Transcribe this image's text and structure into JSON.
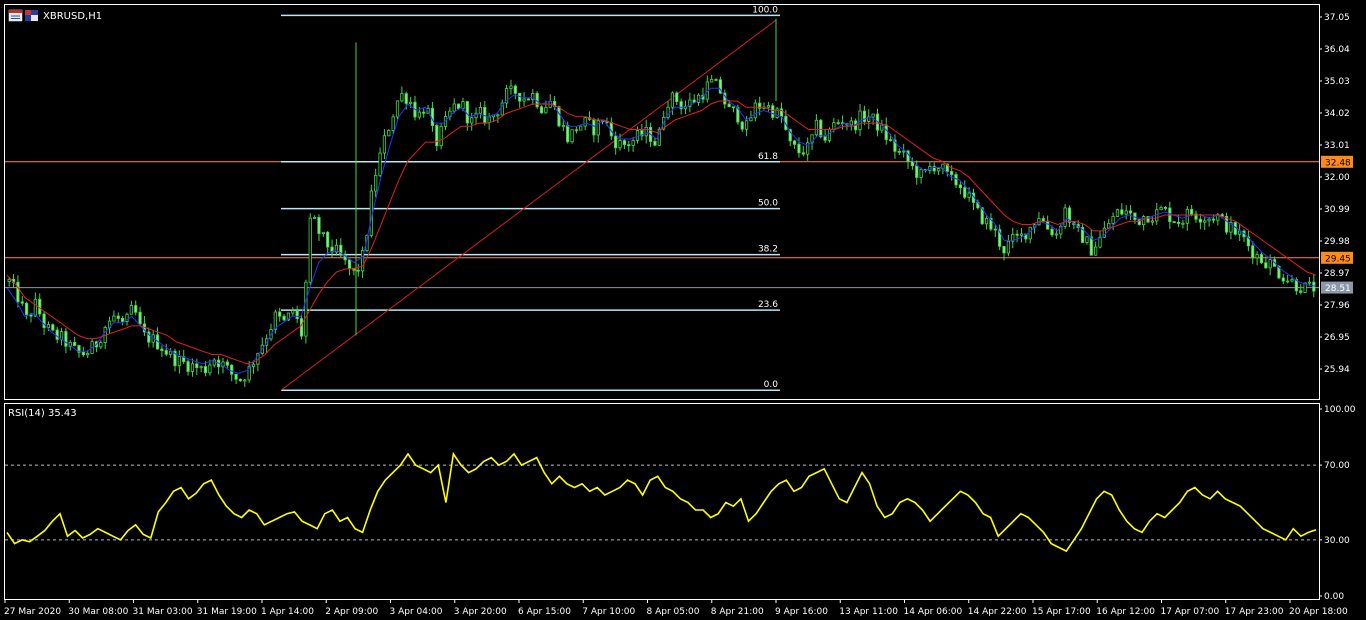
{
  "header": {
    "symbol_title": "XBRUSD,H1",
    "rsi_title": "RSI(14) 35.43"
  },
  "colors": {
    "background": "#000000",
    "border": "#ffffff",
    "candle": "#44d44c",
    "candle_body": "#7cf07c",
    "ma_fast": "#2233ff",
    "ma_slow": "#e02020",
    "fibo": "#b8e6f5",
    "trend_line": "#d02020",
    "hline_orange": "#ff8a30",
    "hline_gray": "#8a98a8",
    "rsi_line": "#ffff00",
    "rsi_level": "#bbbbbb",
    "tag_orange": "#ff8c1a",
    "tag_gray": "#8a98a8"
  },
  "chart_data": [
    {
      "type": "candlestick",
      "title": "XBRUSD,H1",
      "ylim": [
        25.2,
        37.3
      ],
      "y_ticks": [
        37.05,
        36.04,
        35.03,
        34.02,
        33.01,
        32.0,
        30.99,
        29.98,
        28.97,
        27.96,
        26.95,
        25.94
      ],
      "x_ticks": [
        "27 Mar 2020",
        "30 Mar 08:00",
        "31 Mar 03:00",
        "31 Mar 19:00",
        "1 Apr 14:00",
        "2 Apr 09:00",
        "3 Apr 04:00",
        "3 Apr 20:00",
        "6 Apr 15:00",
        "7 Apr 10:00",
        "8 Apr 05:00",
        "8 Apr 21:00",
        "9 Apr 16:00",
        "13 Apr 11:00",
        "14 Apr 06:00",
        "14 Apr 22:00",
        "15 Apr 17:00",
        "16 Apr 12:00",
        "17 Apr 07:00",
        "17 Apr 23:00",
        "20 Apr 18:00"
      ],
      "close_path": [
        28.7,
        28.2,
        27.5,
        28.0,
        27.3,
        27.0,
        26.9,
        26.6,
        26.4,
        26.5,
        26.8,
        27.4,
        27.6,
        27.3,
        27.9,
        27.0,
        26.9,
        26.7,
        26.4,
        26.2,
        26.1,
        26.0,
        25.9,
        26.3,
        26.1,
        25.8,
        25.6,
        25.9,
        26.5,
        27.0,
        27.6,
        27.4,
        27.8,
        27.0,
        30.8,
        30.2,
        29.8,
        29.6,
        29.2,
        28.9,
        29.6,
        31.8,
        32.9,
        33.8,
        34.6,
        34.5,
        33.9,
        34.3,
        33.0,
        33.6,
        34.2,
        34.3,
        33.7,
        34.0,
        33.8,
        34.1,
        34.6,
        34.7,
        34.5,
        34.6,
        34.2,
        34.4,
        33.8,
        33.2,
        33.6,
        33.7,
        33.5,
        33.9,
        33.2,
        33.0,
        33.1,
        33.3,
        33.4,
        33.0,
        34.4,
        34.5,
        34.2,
        34.4,
        34.6,
        35.0,
        34.8,
        34.1,
        34.0,
        33.5,
        34.2,
        34.3,
        34.1,
        33.9,
        33.0,
        32.8,
        32.9,
        33.6,
        33.2,
        33.7,
        33.8,
        33.6,
        33.9,
        33.9,
        33.6,
        33.2,
        32.8,
        32.6,
        32.2,
        32.0,
        32.4,
        32.3,
        31.9,
        31.8,
        31.4,
        30.9,
        30.6,
        30.3,
        29.7,
        30.0,
        30.1,
        30.4,
        30.8,
        30.4,
        30.2,
        31.0,
        30.3,
        30.1,
        29.7,
        30.1,
        30.6,
        30.9,
        30.9,
        30.6,
        30.8,
        30.8,
        31.0,
        30.7,
        30.6,
        30.9,
        30.8,
        30.7,
        30.8,
        30.5,
        30.3,
        30.1,
        29.7,
        29.4,
        29.3,
        29.0,
        28.8,
        28.6,
        28.5,
        28.51
      ],
      "series": [
        {
          "name": "MA fast",
          "values": [
            28.5,
            28.1,
            27.6,
            27.7,
            27.4,
            27.1,
            26.9,
            26.7,
            26.5,
            26.5,
            26.7,
            27.1,
            27.4,
            27.4,
            27.6,
            27.3,
            27.0,
            26.8,
            26.6,
            26.4,
            26.3,
            26.2,
            26.1,
            26.2,
            26.1,
            25.9,
            25.8,
            25.9,
            26.3,
            26.7,
            27.2,
            27.4,
            27.6,
            27.6,
            28.5,
            29.3,
            29.6,
            29.7,
            29.5,
            29.3,
            29.5,
            30.8,
            32.0,
            33.0,
            33.9,
            34.3,
            34.1,
            34.2,
            33.7,
            33.7,
            34.0,
            34.2,
            33.9,
            34.0,
            33.9,
            34.0,
            34.4,
            34.6,
            34.5,
            34.5,
            34.3,
            34.4,
            34.0,
            33.6,
            33.6,
            33.7,
            33.6,
            33.8,
            33.4,
            33.2,
            33.2,
            33.3,
            33.4,
            33.2,
            33.9,
            34.2,
            34.2,
            34.3,
            34.5,
            34.8,
            34.8,
            34.4,
            34.2,
            33.8,
            34.0,
            34.1,
            34.0,
            33.9,
            33.4,
            33.1,
            33.0,
            33.3,
            33.3,
            33.5,
            33.7,
            33.6,
            33.8,
            33.9,
            33.7,
            33.4,
            33.0,
            32.8,
            32.4,
            32.2,
            32.3,
            32.3,
            32.0,
            31.9,
            31.6,
            31.2,
            30.8,
            30.5,
            30.0,
            30.0,
            30.1,
            30.3,
            30.6,
            30.5,
            30.3,
            30.7,
            30.5,
            30.3,
            30.0,
            30.1,
            30.4,
            30.7,
            30.8,
            30.7,
            30.7,
            30.8,
            30.9,
            30.8,
            30.7,
            30.8,
            30.8,
            30.7,
            30.8,
            30.6,
            30.4,
            30.2,
            29.9,
            29.6,
            29.4,
            29.1,
            28.9,
            28.7,
            28.6,
            28.55
          ]
        },
        {
          "name": "MA slow",
          "values": [
            28.9,
            28.6,
            28.2,
            28.0,
            27.8,
            27.6,
            27.4,
            27.2,
            27.0,
            26.9,
            26.9,
            27.0,
            27.1,
            27.2,
            27.3,
            27.3,
            27.2,
            27.1,
            27.0,
            26.8,
            26.7,
            26.6,
            26.5,
            26.4,
            26.4,
            26.3,
            26.2,
            26.1,
            26.2,
            26.4,
            26.7,
            26.9,
            27.1,
            27.3,
            27.8,
            28.3,
            28.7,
            29.0,
            29.1,
            29.1,
            29.2,
            29.8,
            30.5,
            31.2,
            31.9,
            32.5,
            32.8,
            33.1,
            33.1,
            33.2,
            33.4,
            33.6,
            33.6,
            33.7,
            33.7,
            33.8,
            34.0,
            34.1,
            34.2,
            34.3,
            34.3,
            34.3,
            34.2,
            34.0,
            33.9,
            33.9,
            33.8,
            33.8,
            33.7,
            33.6,
            33.5,
            33.5,
            33.5,
            33.4,
            33.6,
            33.8,
            33.9,
            34.0,
            34.1,
            34.3,
            34.4,
            34.4,
            34.4,
            34.2,
            34.2,
            34.2,
            34.1,
            34.1,
            33.9,
            33.7,
            33.5,
            33.5,
            33.5,
            33.5,
            33.6,
            33.6,
            33.7,
            33.7,
            33.7,
            33.6,
            33.4,
            33.2,
            33.0,
            32.8,
            32.6,
            32.5,
            32.3,
            32.2,
            32.0,
            31.7,
            31.4,
            31.1,
            30.8,
            30.6,
            30.5,
            30.5,
            30.6,
            30.6,
            30.5,
            30.6,
            30.6,
            30.5,
            30.3,
            30.3,
            30.4,
            30.5,
            30.6,
            30.6,
            30.7,
            30.7,
            30.8,
            30.8,
            30.8,
            30.8,
            30.8,
            30.8,
            30.8,
            30.7,
            30.6,
            30.4,
            30.2,
            30.0,
            29.8,
            29.6,
            29.4,
            29.2,
            29.0,
            28.9
          ]
        }
      ],
      "fibonacci": {
        "levels": [
          {
            "label": "100.0",
            "price": 37.1
          },
          {
            "label": "61.8",
            "price": 32.48
          },
          {
            "label": "50.0",
            "price": 31.0
          },
          {
            "label": "38.2",
            "price": 29.55
          },
          {
            "label": "23.6",
            "price": 27.8
          },
          {
            "label": "0.0",
            "price": 25.27
          }
        ],
        "trend_line": {
          "from_price": 25.27,
          "to_price": 36.95
        }
      },
      "horizontal_lines": [
        {
          "price": 32.48,
          "label": "32.48",
          "kind": "orange"
        },
        {
          "price": 29.45,
          "label": "29.45",
          "kind": "orange"
        },
        {
          "price": 28.51,
          "label": "28.51",
          "kind": "gray"
        }
      ]
    },
    {
      "type": "line",
      "title": "RSI(14) 35.43",
      "ylim": [
        0,
        100
      ],
      "y_ticks": [
        "100.00",
        "70.00",
        "30.00",
        "0.00"
      ],
      "levels": [
        70,
        30
      ],
      "values": [
        34,
        28,
        30,
        29,
        32,
        35,
        40,
        44,
        32,
        35,
        31,
        33,
        36,
        34,
        32,
        30,
        35,
        38,
        33,
        31,
        45,
        50,
        56,
        58,
        52,
        55,
        60,
        62,
        54,
        48,
        44,
        42,
        46,
        44,
        38,
        40,
        42,
        44,
        45,
        40,
        38,
        36,
        44,
        46,
        40,
        42,
        36,
        34,
        46,
        56,
        62,
        66,
        70,
        76,
        70,
        68,
        66,
        70,
        50,
        76,
        70,
        66,
        68,
        72,
        74,
        70,
        72,
        76,
        70,
        72,
        74,
        66,
        60,
        64,
        60,
        58,
        60,
        56,
        58,
        54,
        56,
        58,
        62,
        60,
        54,
        62,
        64,
        58,
        56,
        52,
        50,
        46,
        46,
        42,
        44,
        50,
        48,
        52,
        40,
        44,
        50,
        56,
        60,
        62,
        56,
        58,
        64,
        66,
        68,
        60,
        52,
        50,
        58,
        66,
        60,
        48,
        42,
        44,
        50,
        52,
        50,
        46,
        40,
        44,
        48,
        52,
        56,
        54,
        50,
        44,
        42,
        32,
        36,
        40,
        44,
        42,
        38,
        34,
        28,
        26,
        24,
        30,
        36,
        44,
        52,
        56,
        54,
        46,
        40,
        36,
        34,
        40,
        44,
        42,
        46,
        50,
        56,
        58,
        54,
        52,
        56,
        52,
        50,
        48,
        44,
        40,
        36,
        34,
        32,
        30,
        36,
        32,
        34,
        35.43
      ]
    }
  ]
}
